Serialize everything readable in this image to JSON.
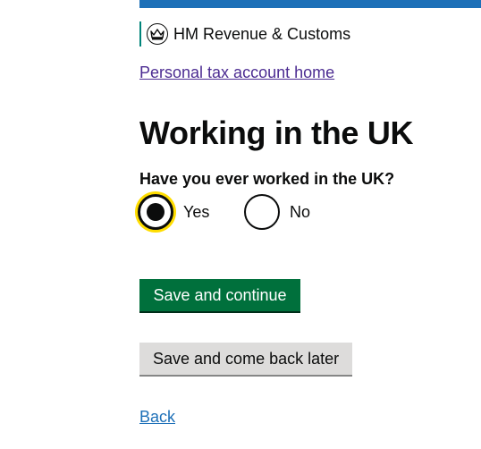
{
  "header": {
    "bar_color": "#1d70b8",
    "org_name": "HM Revenue & Customs",
    "crest_icon": "crown-icon"
  },
  "nav": {
    "home_link": "Personal tax account home"
  },
  "main": {
    "title": "Working in the UK",
    "question": "Have you ever worked in the UK?",
    "options": [
      {
        "label": "Yes",
        "selected": true
      },
      {
        "label": "No",
        "selected": false
      }
    ],
    "primary_button": "Save and continue",
    "secondary_button": "Save and come back later",
    "back_link": "Back"
  },
  "colors": {
    "primary_button": "#00703c",
    "secondary_button": "#dddcdb",
    "focus": "#ffdd00",
    "visited_link": "#4c2c92",
    "link": "#1d70b8"
  }
}
